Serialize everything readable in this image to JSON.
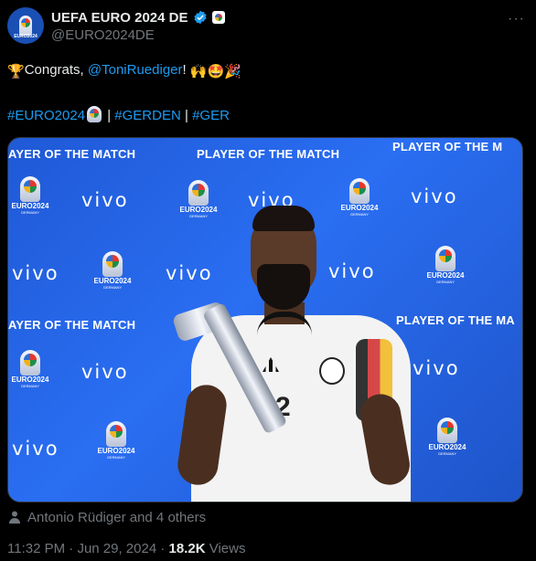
{
  "header": {
    "display_name": "UEFA EURO 2024 DE",
    "handle": "@EURO2024DE",
    "avatar_text": "EURO2024",
    "verified_icon": "verified-badge-icon",
    "affiliation_icon": "euro2024-affiliate-icon",
    "more_label": "···"
  },
  "tweet": {
    "line1": {
      "emoji_lead": "🏆",
      "text_before": "Congrats, ",
      "mention": "@ToniRuediger",
      "text_after": "! ",
      "emoji_tail": "🙌🤩🎉"
    },
    "line2": {
      "hashtag1": "#EURO2024",
      "sep1": " | ",
      "hashtag2": "#GERDEN",
      "sep2": " | ",
      "hashtag3": "#GER"
    }
  },
  "photo": {
    "banner_text_1": "AYER OF THE MATCH",
    "banner_text_2": "PLAYER OF THE MATCH",
    "banner_text_3": "PLAYER OF THE M",
    "banner_text_4": "AYER OF THE MATCH",
    "banner_text_5": "PLAYER OF THE MA",
    "sponsor": "vivo",
    "logo_title": "EURO2024",
    "logo_sub": "GERMANY",
    "shirt_number": "2"
  },
  "tagged": {
    "text": "Antonio Rüdiger and 4 others"
  },
  "meta": {
    "time": "11:32 PM",
    "dot1": " · ",
    "date": "Jun 29, 2024",
    "dot2": " · ",
    "views_count": "18.2K",
    "views_label": " Views"
  },
  "colors": {
    "background": "#000000",
    "link": "#1d9bf0",
    "muted": "#71767b",
    "photo_blue": "#2a6ef2"
  }
}
